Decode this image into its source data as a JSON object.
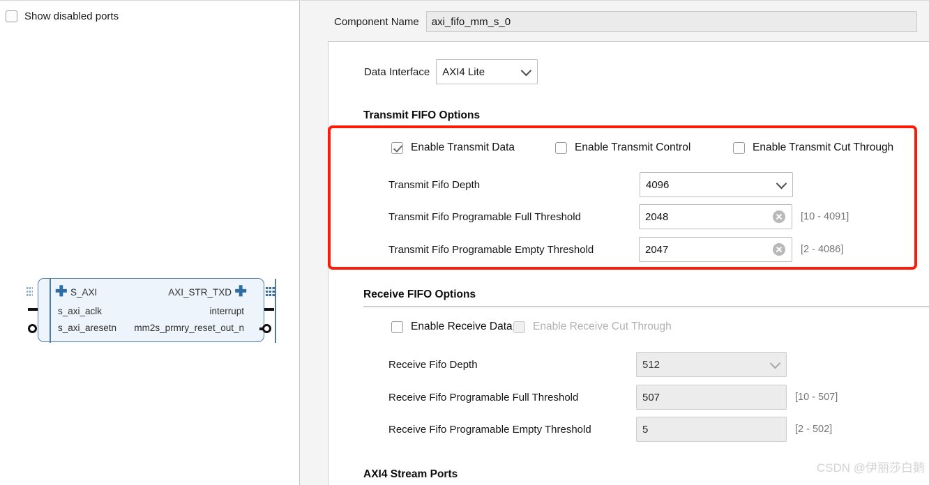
{
  "left_panel": {
    "show_disabled_ports_label": "Show disabled ports",
    "show_disabled_ports_checked": false,
    "diagram": {
      "left_ports": [
        "S_AXI",
        "s_axi_aclk",
        "s_axi_aresetn"
      ],
      "right_ports": [
        "AXI_STR_TXD",
        "interrupt",
        "mm2s_prmry_reset_out_n"
      ]
    }
  },
  "header": {
    "component_name_label": "Component Name",
    "component_name_value": "axi_fifo_mm_s_0"
  },
  "config": {
    "data_interface_label": "Data Interface",
    "data_interface_value": "AXI4 Lite",
    "transmit_section": {
      "title": "Transmit FIFO Options",
      "checkboxes": [
        {
          "label": "Enable Transmit Data",
          "checked": true,
          "disabled": false
        },
        {
          "label": "Enable Transmit Control",
          "checked": false,
          "disabled": false
        },
        {
          "label": "Enable Transmit Cut Through",
          "checked": false,
          "disabled": false
        }
      ],
      "fields": [
        {
          "label": "Transmit Fifo Depth",
          "value": "4096",
          "type": "combo",
          "disabled": false,
          "range": ""
        },
        {
          "label": "Transmit Fifo Programable Full Threshold",
          "value": "2048",
          "type": "text",
          "disabled": false,
          "range": "[10 - 4091]"
        },
        {
          "label": "Transmit Fifo Programable Empty Threshold",
          "value": "2047",
          "type": "text",
          "disabled": false,
          "range": "[2 - 4086]"
        }
      ]
    },
    "receive_section": {
      "title": "Receive FIFO Options",
      "checkboxes": [
        {
          "label": "Enable Receive Data",
          "checked": false,
          "disabled": false
        },
        {
          "label": "Enable Receive Cut Through",
          "checked": false,
          "disabled": true
        }
      ],
      "fields": [
        {
          "label": "Receive Fifo Depth",
          "value": "512",
          "type": "combo",
          "disabled": true,
          "range": ""
        },
        {
          "label": "Receive Fifo Programable Full Threshold",
          "value": "507",
          "type": "text",
          "disabled": true,
          "range": "[10 - 507]"
        },
        {
          "label": "Receive Fifo Programable Empty Threshold",
          "value": "5",
          "type": "text",
          "disabled": true,
          "range": "[2 - 502]"
        }
      ]
    },
    "stream_ports_section": {
      "title": "AXI4 Stream Ports"
    }
  },
  "watermark": {
    "text": "CSDN @伊丽莎白鹅"
  },
  "colors": {
    "highlight_red": "#fa1b09",
    "block_border_blue": "#4c7ba8",
    "block_fill_blue": "#eef4fb"
  }
}
